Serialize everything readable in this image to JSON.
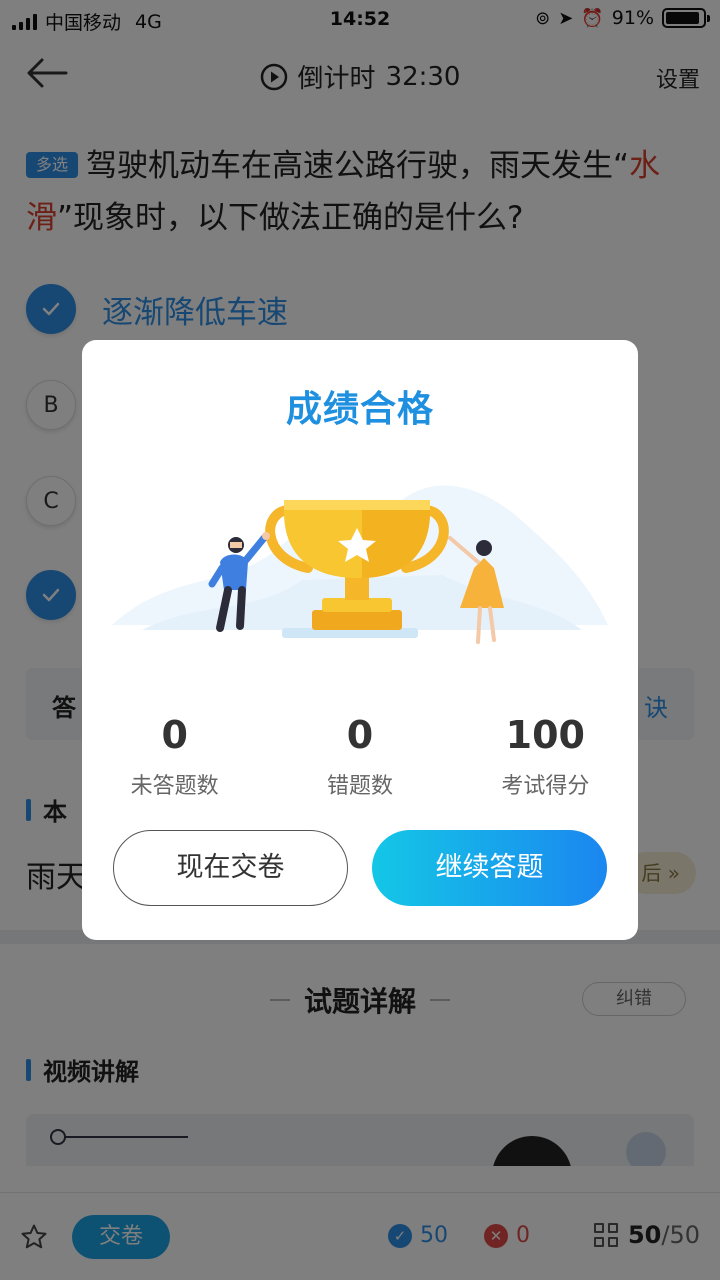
{
  "status_bar": {
    "carrier": "中国移动",
    "network": "4G",
    "time": "14:52",
    "battery": "91%",
    "battery_level": 0.91
  },
  "nav": {
    "countdown_label": "倒计时",
    "countdown_value": "32:30",
    "settings": "设置"
  },
  "question": {
    "type_badge": "多选",
    "text_pre": "驾驶机动车在高速公路行驶，雨天发生“",
    "text_highlight": "水滑",
    "text_post": "”现象时，以下做法正确的是什么?",
    "options": [
      {
        "key": "A",
        "text": "逐渐降低车速",
        "checked": true
      },
      {
        "key": "B",
        "text": "",
        "checked": false
      },
      {
        "key": "C",
        "text": "",
        "checked": false
      },
      {
        "key": "D",
        "text": "",
        "checked": true
      }
    ]
  },
  "answer_bar": {
    "label": "答",
    "tip": "诀"
  },
  "section": {
    "title_partial": "本"
  },
  "explain": {
    "text_partial": "雨天",
    "tag": "后 »"
  },
  "detail": {
    "title": "试题详解",
    "report": "纠错",
    "video_title": "视频讲解"
  },
  "bottom": {
    "submit": "交卷",
    "correct_count": "50",
    "wrong_count": "0",
    "progress_current": "50",
    "progress_total": "/50"
  },
  "modal": {
    "title": "成绩合格",
    "stats": [
      {
        "value": "0",
        "label": "未答题数"
      },
      {
        "value": "0",
        "label": "错题数"
      },
      {
        "value": "100",
        "label": "考试得分"
      }
    ],
    "btn_submit_now": "现在交卷",
    "btn_continue": "继续答题"
  },
  "colors": {
    "accent": "#2f8fe6",
    "title_blue": "#1f8fe0",
    "highlight_red": "#d8402c",
    "wrong_red": "#e04848",
    "trophy_gold": "#f8c630"
  }
}
